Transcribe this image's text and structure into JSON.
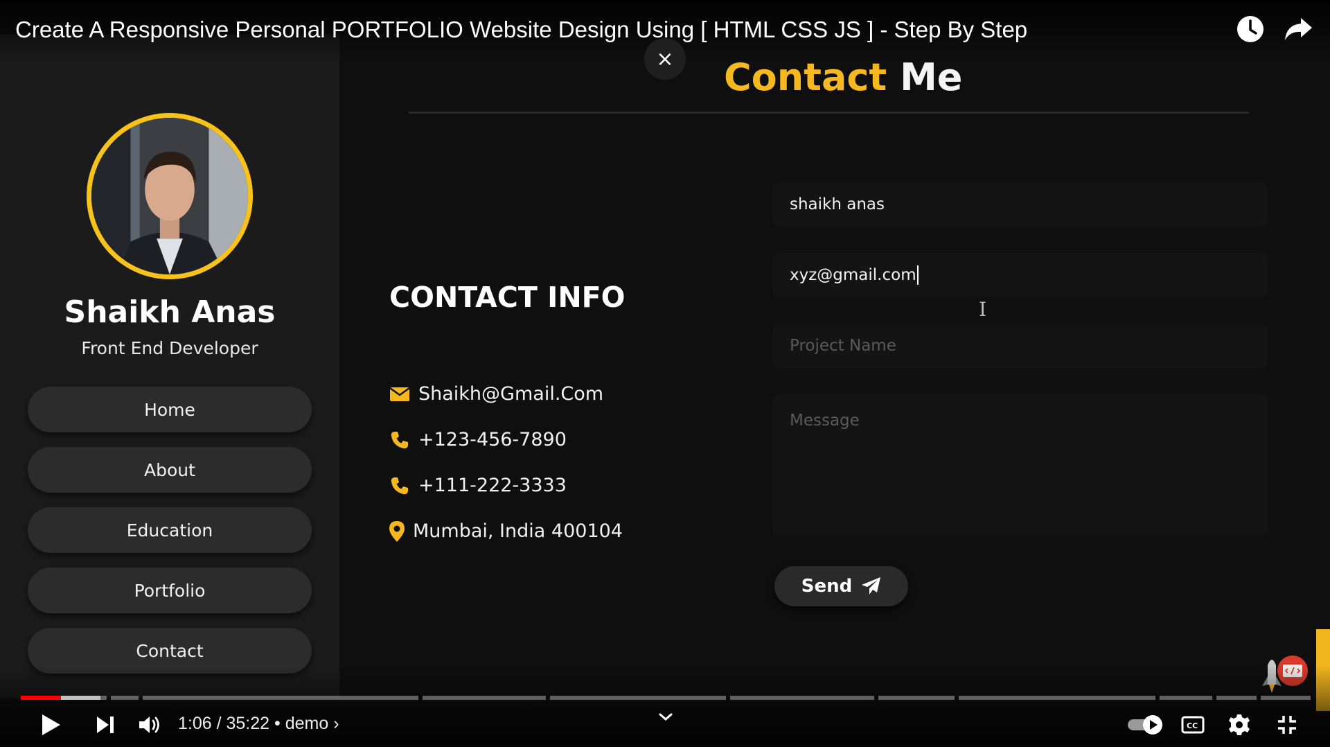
{
  "video": {
    "title": "Create A Responsive Personal PORTFOLIO Website Design Using [ HTML CSS JS ] - Step By Step",
    "close_label": "×"
  },
  "portfolio": {
    "accent_color": "#f5b820",
    "profile": {
      "name": "Shaikh Anas",
      "role": "Front End Developer"
    },
    "nav": [
      {
        "label": "Home"
      },
      {
        "label": "About"
      },
      {
        "label": "Education"
      },
      {
        "label": "Portfolio"
      },
      {
        "label": "Contact"
      }
    ],
    "heading": {
      "accent": "Contact",
      "rest": "Me"
    },
    "contact_info": {
      "title": "CONTACT INFO",
      "email": {
        "icon": "envelope-icon",
        "text": "Shaikh@Gmail.Com"
      },
      "phone1": {
        "icon": "phone-icon",
        "text": "+123-456-7890"
      },
      "phone2": {
        "icon": "phone-icon",
        "text": "+111-222-3333"
      },
      "address": {
        "icon": "map-marker-icon",
        "text": "Mumbai, India 400104"
      }
    },
    "form": {
      "name_value": "shaikh anas",
      "email_value": "xyz@gmail.com",
      "project_placeholder": "Project Name",
      "message_placeholder": "Message",
      "send_label": "Send"
    }
  },
  "player": {
    "time": "1:06 / 35:22",
    "chapter": "demo",
    "progress_fraction": 0.031,
    "buffered_fraction": 0.062,
    "progress_color": "#ff0000"
  }
}
